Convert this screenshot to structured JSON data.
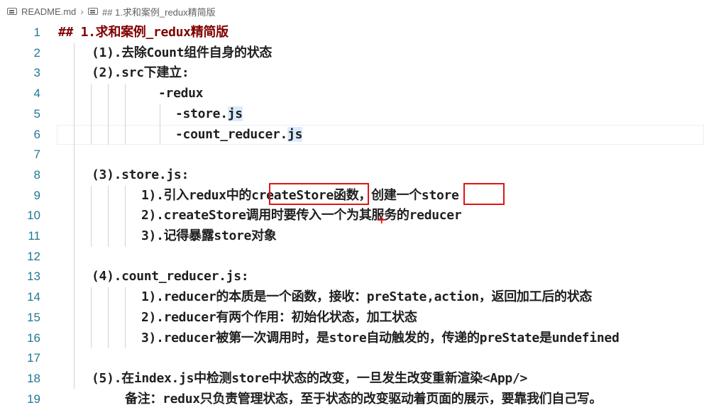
{
  "breadcrumb": {
    "file": "README.md",
    "section": "## 1.求和案例_redux精简版",
    "file_icon": "markdown-file-icon",
    "section_icon": "heading-symbol-icon"
  },
  "lines": [
    {
      "n": "1",
      "text": "## 1.求和案例_redux精简版"
    },
    {
      "n": "2",
      "text": "(1).去除Count组件自身的状态"
    },
    {
      "n": "3",
      "text": "(2).src下建立:"
    },
    {
      "n": "4",
      "text": "-redux"
    },
    {
      "n": "5",
      "text": "-store.",
      "tail": "js"
    },
    {
      "n": "6",
      "text": "-count_reducer.",
      "tail": "js"
    },
    {
      "n": "7",
      "text": ""
    },
    {
      "n": "8",
      "text": "(3).store.js:"
    },
    {
      "n": "9",
      "text": "1).引入redux中的createStore函数，创建一个store"
    },
    {
      "n": "10",
      "text": "2).createStore调用时要传入一个为其服务的reducer"
    },
    {
      "n": "11",
      "text": "3).记得暴露store对象"
    },
    {
      "n": "12",
      "text": ""
    },
    {
      "n": "13",
      "text": "(4).count_reducer.js:"
    },
    {
      "n": "14",
      "text": "1).reducer的本质是一个函数，接收：preState,action，返回加工后的状态"
    },
    {
      "n": "15",
      "text": "2).reducer有两个作用：初始化状态，加工状态"
    },
    {
      "n": "16",
      "text": "3).reducer被第一次调用时，是store自动触发的，传递的preState是undefined"
    },
    {
      "n": "17",
      "text": ""
    },
    {
      "n": "18",
      "text": "(5).在index.js中检测store中状态的改变，一旦发生改变重新渲染<App/>"
    },
    {
      "n": "19",
      "text": "备注：redux只负责管理状态，至于状态的改变驱动着页面的展示，要靠我们自己写。"
    }
  ],
  "colors": {
    "line_number": "#237893",
    "heading": "#800000",
    "text": "#1f1f1f",
    "highlight_box": "#e01414",
    "selection": "#dcebfc"
  }
}
